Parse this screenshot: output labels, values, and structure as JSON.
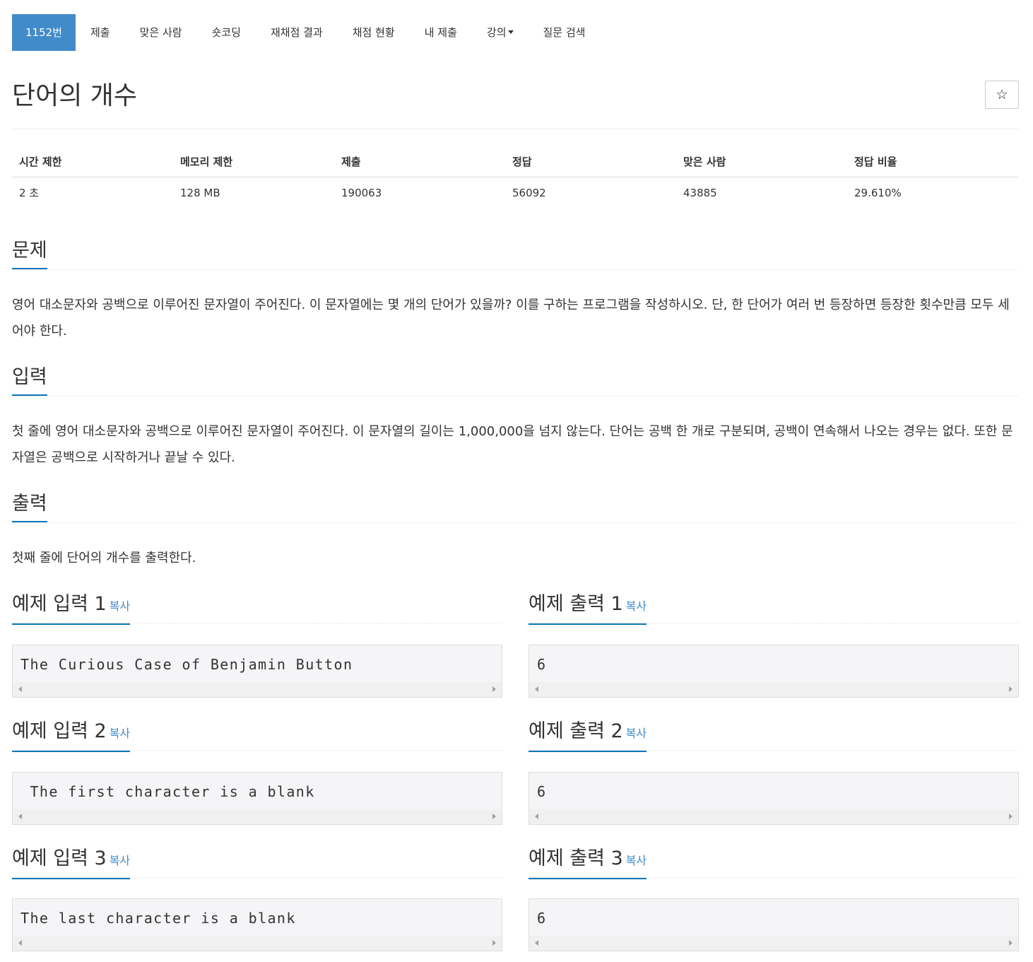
{
  "nav": {
    "items": [
      {
        "label": "1152번"
      },
      {
        "label": "제출"
      },
      {
        "label": "맞은 사람"
      },
      {
        "label": "숏코딩"
      },
      {
        "label": "재채점 결과"
      },
      {
        "label": "채점 현황"
      },
      {
        "label": "내 제출"
      },
      {
        "label": "강의"
      },
      {
        "label": "질문 검색"
      }
    ]
  },
  "problem": {
    "title": "단어의 개수",
    "star": "☆"
  },
  "info": {
    "headers": [
      "시간 제한",
      "메모리 제한",
      "제출",
      "정답",
      "맞은 사람",
      "정답 비율"
    ],
    "values": [
      "2 초",
      "128 MB",
      "190063",
      "56092",
      "43885",
      "29.610%"
    ]
  },
  "sections": {
    "description": {
      "heading": "문제",
      "text": "영어 대소문자와 공백으로 이루어진 문자열이 주어진다. 이 문자열에는 몇 개의 단어가 있을까? 이를 구하는 프로그램을 작성하시오. 단, 한 단어가 여러 번 등장하면 등장한 횟수만큼 모두 세어야 한다."
    },
    "input": {
      "heading": "입력",
      "text": "첫 줄에 영어 대소문자와 공백으로 이루어진 문자열이 주어진다. 이 문자열의 길이는 1,000,000을 넘지 않는다. 단어는 공백 한 개로 구분되며, 공백이 연속해서 나오는 경우는 없다. 또한 문자열은 공백으로 시작하거나 끝날 수 있다."
    },
    "output": {
      "heading": "출력",
      "text": "첫째 줄에 단어의 개수를 출력한다."
    }
  },
  "copy_label": "복사",
  "samples": [
    {
      "input_heading": "예제 입력 1",
      "output_heading": "예제 출력 1",
      "input": "The Curious Case of Benjamin Button",
      "output": "6"
    },
    {
      "input_heading": "예제 입력 2",
      "output_heading": "예제 출력 2",
      "input": " The first character is a blank",
      "output": "6"
    },
    {
      "input_heading": "예제 입력 3",
      "output_heading": "예제 출력 3",
      "input": "The last character is a blank ",
      "output": "6"
    }
  ],
  "colors": {
    "accent": "#428bca",
    "heading_underline": "#0e76b8",
    "sample_bg": "#f5f5f7"
  }
}
